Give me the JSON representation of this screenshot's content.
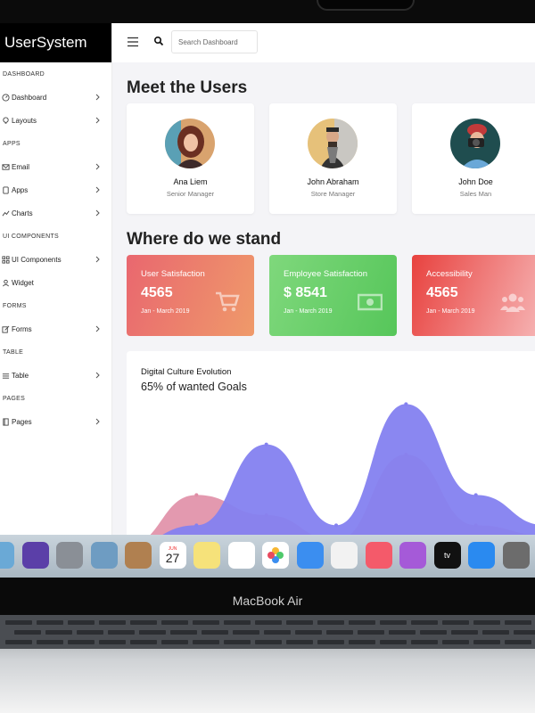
{
  "app": {
    "brand": "UserSystem"
  },
  "sidebar": {
    "sections": [
      {
        "title": "DASHBOARD",
        "items": [
          {
            "label": "Dashboard",
            "icon": "gauge-icon"
          },
          {
            "label": "Layouts",
            "icon": "bulb-icon"
          }
        ]
      },
      {
        "title": "APPS",
        "items": [
          {
            "label": "Email",
            "icon": "mail-icon"
          },
          {
            "label": "Apps",
            "icon": "tablet-icon"
          },
          {
            "label": "Charts",
            "icon": "line-chart-icon"
          }
        ]
      },
      {
        "title": "UI COMPONENTS",
        "items": [
          {
            "label": "UI Components",
            "icon": "grid-icon"
          },
          {
            "label": "Widget",
            "icon": "user-widget-icon"
          }
        ]
      },
      {
        "title": "FORMS",
        "items": [
          {
            "label": "Forms",
            "icon": "edit-icon"
          }
        ]
      },
      {
        "title": "TABLE",
        "items": [
          {
            "label": "Table",
            "icon": "table-icon"
          }
        ]
      },
      {
        "title": "PAGES",
        "items": [
          {
            "label": "Pages",
            "icon": "pages-icon"
          }
        ]
      }
    ]
  },
  "topbar": {
    "search_placeholder": "Search Dashboard"
  },
  "users": {
    "title": "Meet the Users",
    "cards": [
      {
        "name": "Ana Liem",
        "role": "Senior Manager"
      },
      {
        "name": "John Abraham",
        "role": "Store Manager"
      },
      {
        "name": "John Doe",
        "role": "Sales Man"
      }
    ]
  },
  "stats": {
    "title": "Where do we stand",
    "cards": [
      {
        "title": "User Satisfaction",
        "value": "4565",
        "period": "Jan - March 2019",
        "icon": "cart-icon",
        "color_from": "#e9676f",
        "color_to": "#ef9a6a"
      },
      {
        "title": "Employee Satisfaction",
        "value": "$ 8541",
        "period": "Jan - March 2019",
        "icon": "money-icon",
        "color_from": "#7fd87c",
        "color_to": "#56c65a"
      },
      {
        "title": "Accessibility",
        "value": "4565",
        "period": "Jan - March 2019",
        "icon": "users-icon",
        "color_from": "#e8423f",
        "color_to": "#f6b3b3"
      }
    ]
  },
  "chart": {
    "title": "Digital Culture Evolution",
    "subtitle": "65% of wanted Goals",
    "colors": {
      "series_a": "#e08ea6",
      "series_b": "#8481f0"
    }
  },
  "chart_data": {
    "type": "area",
    "title": "Digital Culture Evolution",
    "subtitle": "65% of wanted Goals",
    "x": [
      0,
      1,
      2,
      3,
      4,
      5,
      6
    ],
    "series": [
      {
        "values": [
          0,
          50,
          30,
          5,
          90,
          20,
          10
        ]
      },
      {
        "values": [
          0,
          20,
          100,
          20,
          140,
          50,
          20
        ]
      }
    ]
  },
  "dock": {
    "items": [
      "Finder",
      "Siri",
      "Launchpad",
      "Preview",
      "Contacts",
      "Calendar",
      "Notes",
      "Reminders",
      "Photos",
      "Messages",
      "News",
      "Music",
      "Podcasts",
      "TV",
      "App Store",
      "System Preferences"
    ],
    "calendar_month": "JUN",
    "calendar_day": "27",
    "tv_label": "tv"
  },
  "device": {
    "label": "MacBook Air"
  }
}
